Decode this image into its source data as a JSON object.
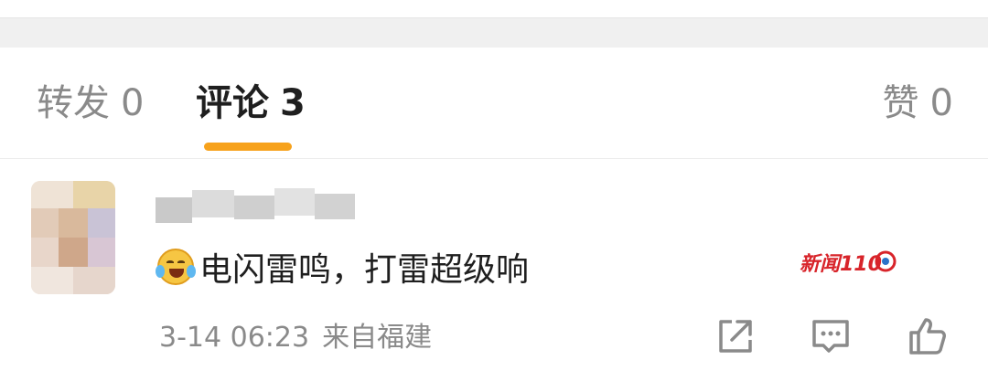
{
  "tabs": {
    "repost": {
      "label": "转发",
      "count": "0"
    },
    "comment": {
      "label": "评论",
      "count": "3"
    },
    "like": {
      "label": "赞",
      "count": "0"
    }
  },
  "comment": {
    "username": "",
    "text": "电闪雷鸣，打雷超级响",
    "emoji": "laugh-cry-emoji",
    "time": "3-14 06:23",
    "location": "来自福建",
    "badge": "新闻110"
  },
  "colors": {
    "accent": "#f7a21c",
    "active_tab": "#1f1f1f",
    "inactive_text": "#8a8a8a",
    "badge_red": "#d8242a"
  }
}
